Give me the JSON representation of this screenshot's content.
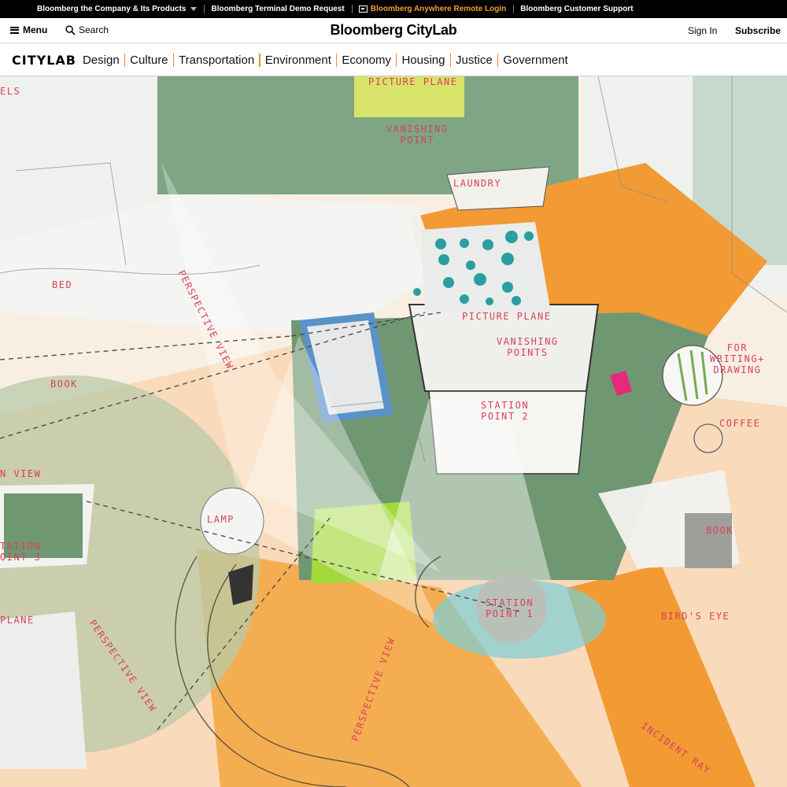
{
  "topbar": {
    "links": [
      "Bloomberg the Company & Its Products",
      "Bloomberg Terminal Demo Request",
      "Bloomberg Anywhere Remote Login",
      "Bloomberg Customer Support"
    ],
    "accent_color": "#f0a030"
  },
  "header": {
    "menu_label": "Menu",
    "search_label": "Search",
    "logo": "Bloomberg CityLab",
    "signin_label": "Sign In",
    "subscribe_label": "Subscribe"
  },
  "nav": {
    "brand": "CITYLAB",
    "items": [
      "Design",
      "Culture",
      "Transportation",
      "Environment",
      "Economy",
      "Housing",
      "Justice",
      "Government"
    ],
    "separator_color": "#f08a24"
  },
  "illustration": {
    "labels": {
      "picture_plane_top": "PICTURE PLANE",
      "vanishing_point_top_1": "VANISHING",
      "vanishing_point_top_2": "POINT",
      "laundry": "LAUNDRY",
      "els": "ELS",
      "bed": "BED",
      "perspective_view_1": "PERSPECTIVE VIEW",
      "book_left": "BOOK",
      "picture_plane_mid": "PICTURE PLANE",
      "vanishing_points_1": "VANISHING",
      "vanishing_points_2": "POINTS",
      "station_point_2_a": "STATION",
      "station_point_2_b": "POINT 2",
      "for_writing_1": "FOR",
      "for_writing_2": "WRITING+",
      "for_writing_3": "DRAWING",
      "coffee": "COFFEE",
      "n_view": "N VIEW",
      "lamp": "LAMP",
      "station_point_3_a": "TATION",
      "station_point_3_b": "OINT 3",
      "book_right": "BOOK",
      "station_point_1_a": "STATION",
      "station_point_1_b": "POINT 1",
      "birds_eye": "BIRD'S EYE",
      "plane_left": "PLANE",
      "perspective_view_2": "PERSPECTIVE VIEW",
      "perspective_view_3": "PERSPECTIVE VIEW",
      "incident_ray": "INCIDENT RAY"
    },
    "label_color": "#d9415a"
  }
}
